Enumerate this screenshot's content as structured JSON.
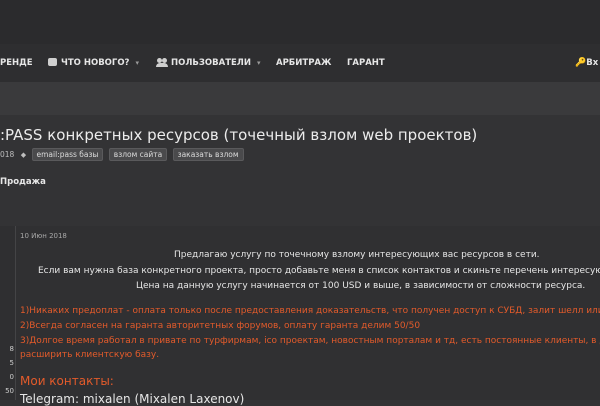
{
  "nav": {
    "item_partial": "РЕНДЕ",
    "whats_new": "ЧТО НОВОГО?",
    "users": "ПОЛЬЗОВАТЕЛИ",
    "arbitrage": "АРБИТРАЖ",
    "guarantee": "ГАРАНТ",
    "login_partial": "Вх"
  },
  "thread": {
    "title": ":PASS конкретных ресурсов (точечный взлом web проектов)",
    "date_partial": "018",
    "tags": [
      "email:pass базы",
      "взлом сайта",
      "заказать взлом"
    ],
    "section": "Продажа"
  },
  "author_stats": [
    "8",
    "5",
    "0",
    "50"
  ],
  "post": {
    "date": "10 Июн 2018",
    "lines": [
      "Предлагаю услугу по точечному взлому интересующих вас ресурсов в сети.",
      "Если вам нужна база конкретного проекта, просто добавьте меня в список контактов и скиньте перечень интересующих",
      "Цена на данную услугу начинается от 100 USD и выше, в зависимости от сложности ресурса."
    ],
    "points": [
      "1)Никаких предоплат - оплата только после предоставления доказательств, что получен доступ к СУБД, залит шелл или пору",
      "2)Всегда согласен на гаранта авторитетных форумов, оплату гаранта делим 50/50",
      "3)Долгое время работал в привате по турфирмам, ico проектам, новостным порталам и тд, есть постоянные клиенты, в данны",
      "расширить клиентскую базу."
    ],
    "contacts_heading": "Мои контакты:",
    "telegram": "Telegram: mixalen (Mixalen Laxenov)"
  },
  "colors": {
    "accent_orange": "#e35b2b",
    "background": "#333335"
  }
}
